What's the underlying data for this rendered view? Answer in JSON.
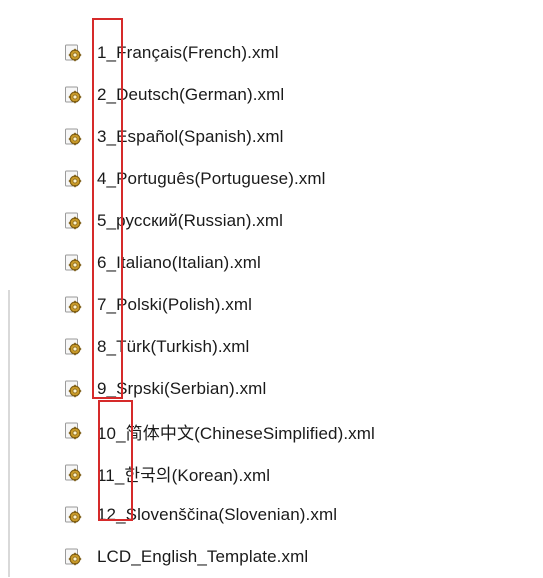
{
  "files": [
    {
      "name": "1_Français(French).xml",
      "icon": "xml-file-icon"
    },
    {
      "name": "2_Deutsch(German).xml",
      "icon": "xml-file-icon"
    },
    {
      "name": "3_Español(Spanish).xml",
      "icon": "xml-file-icon"
    },
    {
      "name": "4_Português(Portuguese).xml",
      "icon": "xml-file-icon"
    },
    {
      "name": "5_русский(Russian).xml",
      "icon": "xml-file-icon"
    },
    {
      "name": "6_Italiano(Italian).xml",
      "icon": "xml-file-icon"
    },
    {
      "name": "7_Polski(Polish).xml",
      "icon": "xml-file-icon"
    },
    {
      "name": "8_Türk(Turkish).xml",
      "icon": "xml-file-icon"
    },
    {
      "name": "9_Srpski(Serbian).xml",
      "icon": "xml-file-icon"
    },
    {
      "name": "10_简体中文(ChineseSimplified).xml",
      "icon": "xml-file-icon"
    },
    {
      "name": "11_한국의(Korean).xml",
      "icon": "xml-file-icon"
    },
    {
      "name": "12_Slovenščina(Slovenian).xml",
      "icon": "xml-file-icon"
    },
    {
      "name": "LCD_English_Template.xml",
      "icon": "xml-file-icon"
    }
  ],
  "colors": {
    "highlight_box": "#d62a2a",
    "text": "#1a1a1a",
    "background": "#ffffff"
  }
}
